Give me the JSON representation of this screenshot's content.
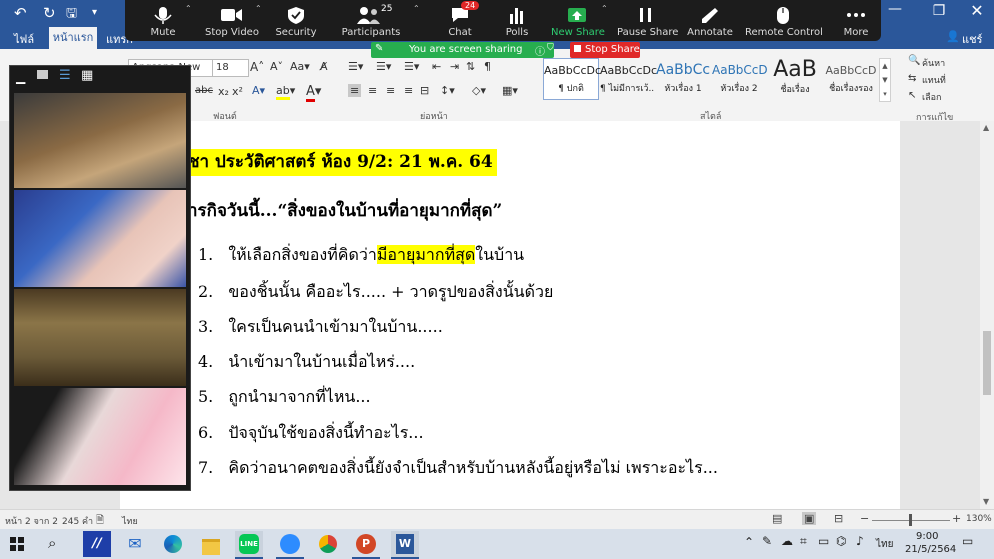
{
  "word": {
    "ribbon_tabs": [
      "ไฟล์",
      "หน้าแรก",
      "แทรก"
    ],
    "share_label": "แชร์",
    "font_name": "Angsana New",
    "font_size": "18",
    "styles": [
      {
        "preview": "AaBbCcDc",
        "name": "¶ ปกติ"
      },
      {
        "preview": "AaBbCcDc",
        "name": "¶ ไม่มีการเว้..."
      },
      {
        "preview": "AaBbCc",
        "name": "หัวเรื่อง 1"
      },
      {
        "preview": "AaBbCcD",
        "name": "หัวเรื่อง 2"
      },
      {
        "preview": "AaB",
        "name": "ชื่อเรื่อง"
      },
      {
        "preview": "AaBbCcD",
        "name": "ชื่อเรื่องรอง"
      }
    ],
    "groups": {
      "font": "ฟอนต์",
      "paragraph": "ย่อหน้า",
      "styles": "สไตล์",
      "editing": "การแก้ไข"
    },
    "editing": {
      "find": "ค้นหา",
      "replace": "แทนที่",
      "select": "เลือก"
    }
  },
  "zoom_toolbar": {
    "items": [
      {
        "label": "Mute",
        "icon": "microphone-icon"
      },
      {
        "label": "Stop Video",
        "icon": "video-camera-icon"
      },
      {
        "label": "Security",
        "icon": "shield-icon"
      },
      {
        "label": "Participants",
        "icon": "participants-icon",
        "count": "25"
      },
      {
        "label": "Chat",
        "icon": "chat-icon",
        "badge": "24"
      },
      {
        "label": "Polls",
        "icon": "polls-icon"
      },
      {
        "label": "New Share",
        "icon": "share-up-arrow-icon"
      },
      {
        "label": "Pause Share",
        "icon": "pause-icon"
      },
      {
        "label": "Annotate",
        "icon": "pen-icon"
      },
      {
        "label": "Remote Control",
        "icon": "mouse-icon"
      },
      {
        "label": "More",
        "icon": "more-dots-icon"
      }
    ],
    "sharing_banner": "You are screen sharing",
    "stop_share": "Stop Share"
  },
  "document": {
    "title_line": "ชา ประวัติศาสตร์ ห้อง 9/2: 21 พ.ค. 64",
    "activity_line": "ารกิจวันนี้...“สิ่งของในบ้านที่อายุมากที่สุด”",
    "items": [
      {
        "num": "1.",
        "before": "ให้เลือกสิ่งของที่คิดว่า",
        "highlight": "มีอายุมากที่สุด",
        "after": "ในบ้าน"
      },
      {
        "num": "2.",
        "before": "ของชิ้นนั้น คืออะไร..... + วาดรูปของสิ่งนั้นด้วย",
        "highlight": "",
        "after": ""
      },
      {
        "num": "3.",
        "before": "ใครเป็นคนนำเข้ามาในบ้าน.....",
        "highlight": "",
        "after": ""
      },
      {
        "num": "4.",
        "before": "นำเข้ามาในบ้านเมื่อไหร่....",
        "highlight": "",
        "after": ""
      },
      {
        "num": "5.",
        "before": "ถูกนำมาจากที่ไหน...",
        "highlight": "",
        "after": ""
      },
      {
        "num": "6.",
        "before": "ปัจจุบันใช้ของสิ่งนี้ทำอะไร...",
        "highlight": "",
        "after": ""
      },
      {
        "num": "7.",
        "before": "คิดว่าอนาคตของสิ่งนี้ยังจำเป็นสำหรับบ้านหลังนี้อยู่หรือไม่ เพราะอะไร...",
        "highlight": "",
        "after": ""
      }
    ]
  },
  "status_bar": {
    "page": "หน้า 2 จาก 2",
    "words": "245 คำ",
    "language": "ไทย",
    "zoom": "130%"
  },
  "taskbar": {
    "language": "ไทย",
    "time": "9:00",
    "date": "21/5/2564"
  }
}
